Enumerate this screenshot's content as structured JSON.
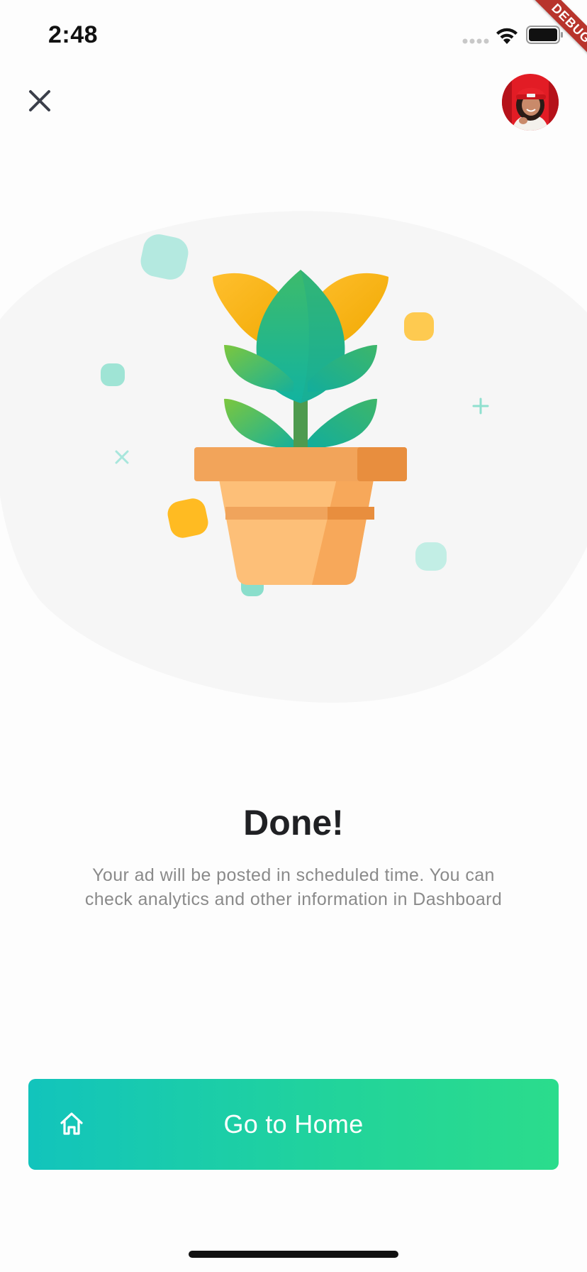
{
  "status_bar": {
    "time": "2:48"
  },
  "debug_banner": {
    "label": "DEBUG"
  },
  "top_bar": {
    "close_icon": "close-icon",
    "avatar": "user-avatar"
  },
  "illustration": {
    "subject": "potted-plant-illustration"
  },
  "content": {
    "title": "Done!",
    "message": "Your ad will be posted in scheduled time. You can check analytics and other information in Dashboard"
  },
  "action": {
    "home_label": "Go to Home",
    "home_icon": "home-icon"
  },
  "colors": {
    "gradient_start": "#12c4bc",
    "gradient_end": "#2bdc8c",
    "title": "#202124",
    "message": "#8a8a8a"
  }
}
